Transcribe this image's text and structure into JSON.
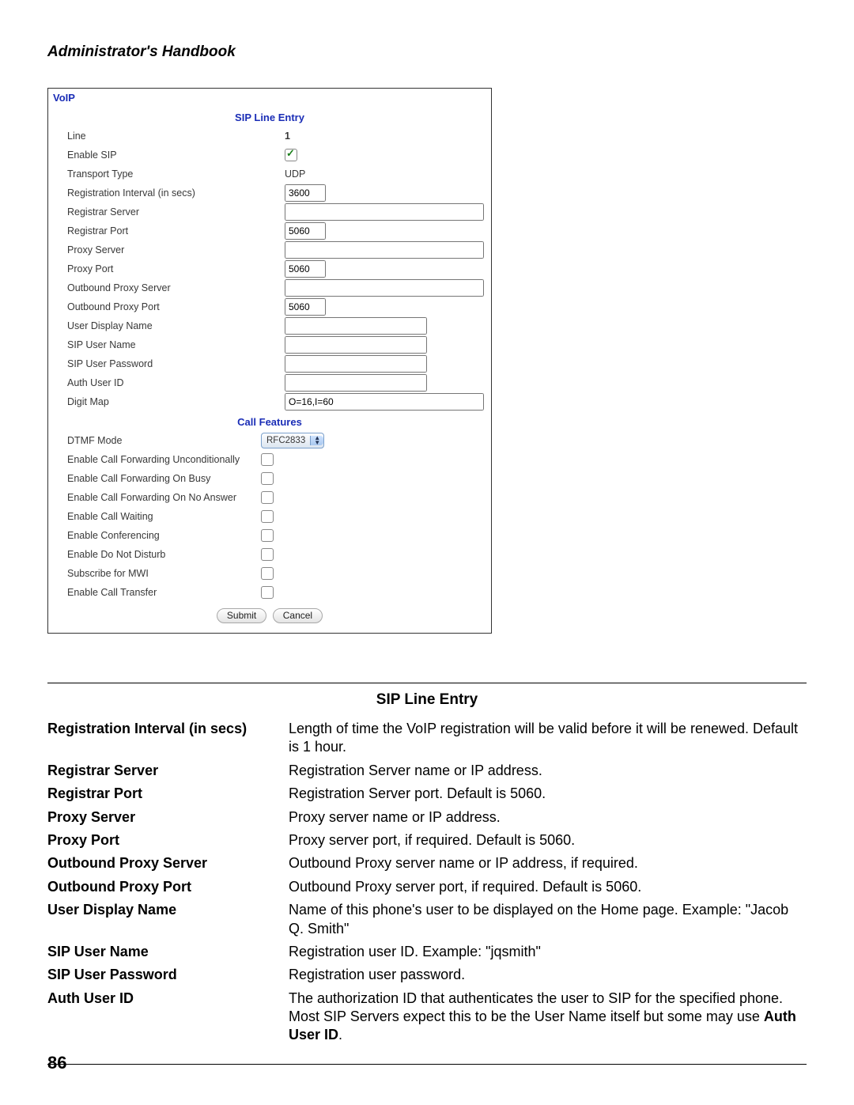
{
  "bookTitle": "Administrator's Handbook",
  "pageNumber": "86",
  "panel": {
    "header": "VoIP",
    "section1": "SIP Line Entry",
    "lineLabel": "Line",
    "lineValue": "1",
    "enableSipLabel": "Enable SIP",
    "transportLabel": "Transport Type",
    "transportValue": "UDP",
    "regIntLabel": "Registration Interval (in secs)",
    "regIntValue": "3600",
    "registrarServerLabel": "Registrar Server",
    "registrarServerValue": "",
    "registrarPortLabel": "Registrar Port",
    "registrarPortValue": "5060",
    "proxyServerLabel": "Proxy Server",
    "proxyServerValue": "",
    "proxyPortLabel": "Proxy Port",
    "proxyPortValue": "5060",
    "outProxyServerLabel": "Outbound Proxy Server",
    "outProxyServerValue": "",
    "outProxyPortLabel": "Outbound Proxy Port",
    "outProxyPortValue": "5060",
    "userDisplayLabel": "User Display Name",
    "userDisplayValue": "",
    "sipUserLabel": "SIP User Name",
    "sipUserValue": "",
    "sipPassLabel": "SIP User Password",
    "sipPassValue": "",
    "authUserLabel": "Auth User ID",
    "authUserValue": "",
    "digitMapLabel": "Digit Map",
    "digitMapValue": "O=16,I=60",
    "section2": "Call Features",
    "dtmfLabel": "DTMF Mode",
    "dtmfValue": "RFC2833",
    "cfUncondLabel": "Enable Call Forwarding Unconditionally",
    "cfBusyLabel": "Enable Call Forwarding On Busy",
    "cfNoAnsLabel": "Enable Call Forwarding On No Answer",
    "callWaitLabel": "Enable Call Waiting",
    "confLabel": "Enable Conferencing",
    "dndLabel": "Enable Do Not Disturb",
    "mwiLabel": "Subscribe for MWI",
    "xferLabel": "Enable Call Transfer",
    "submit": "Submit",
    "cancel": "Cancel"
  },
  "table": {
    "title": "SIP Line Entry",
    "rows": [
      {
        "l": "Registration Interval (in secs)",
        "r": "Length of time the VoIP registration will be valid before it will be renewed. Default is 1 hour."
      },
      {
        "l": "Registrar Server",
        "r": "Registration Server name or IP address."
      },
      {
        "l": "Registrar Port",
        "r": "Registration Server port. Default is 5060."
      },
      {
        "l": "Proxy Server",
        "r": "Proxy server name or IP address."
      },
      {
        "l": "Proxy Port",
        "r": "Proxy server port, if required. Default is 5060."
      },
      {
        "l": "Outbound Proxy Server",
        "r": "Outbound Proxy server name or IP address, if required."
      },
      {
        "l": "Outbound Proxy Port",
        "r": "Outbound Proxy server port, if required. Default is 5060."
      },
      {
        "l": "User Display Name",
        "r": "Name of this phone's user to be displayed on the Home page. Example: \"Jacob Q. Smith\""
      },
      {
        "l": "SIP User Name",
        "r": "Registration user ID. Example: \"jqsmith\""
      },
      {
        "l": "SIP User Password",
        "r": "Registration user password."
      }
    ],
    "authUser": {
      "l": "Auth User ID",
      "pre": "The authorization ID that authenticates the user to SIP for the specified phone. Most SIP Servers expect this to be the User Name itself but some may use ",
      "bold": "Auth User ID",
      "post": "."
    }
  }
}
